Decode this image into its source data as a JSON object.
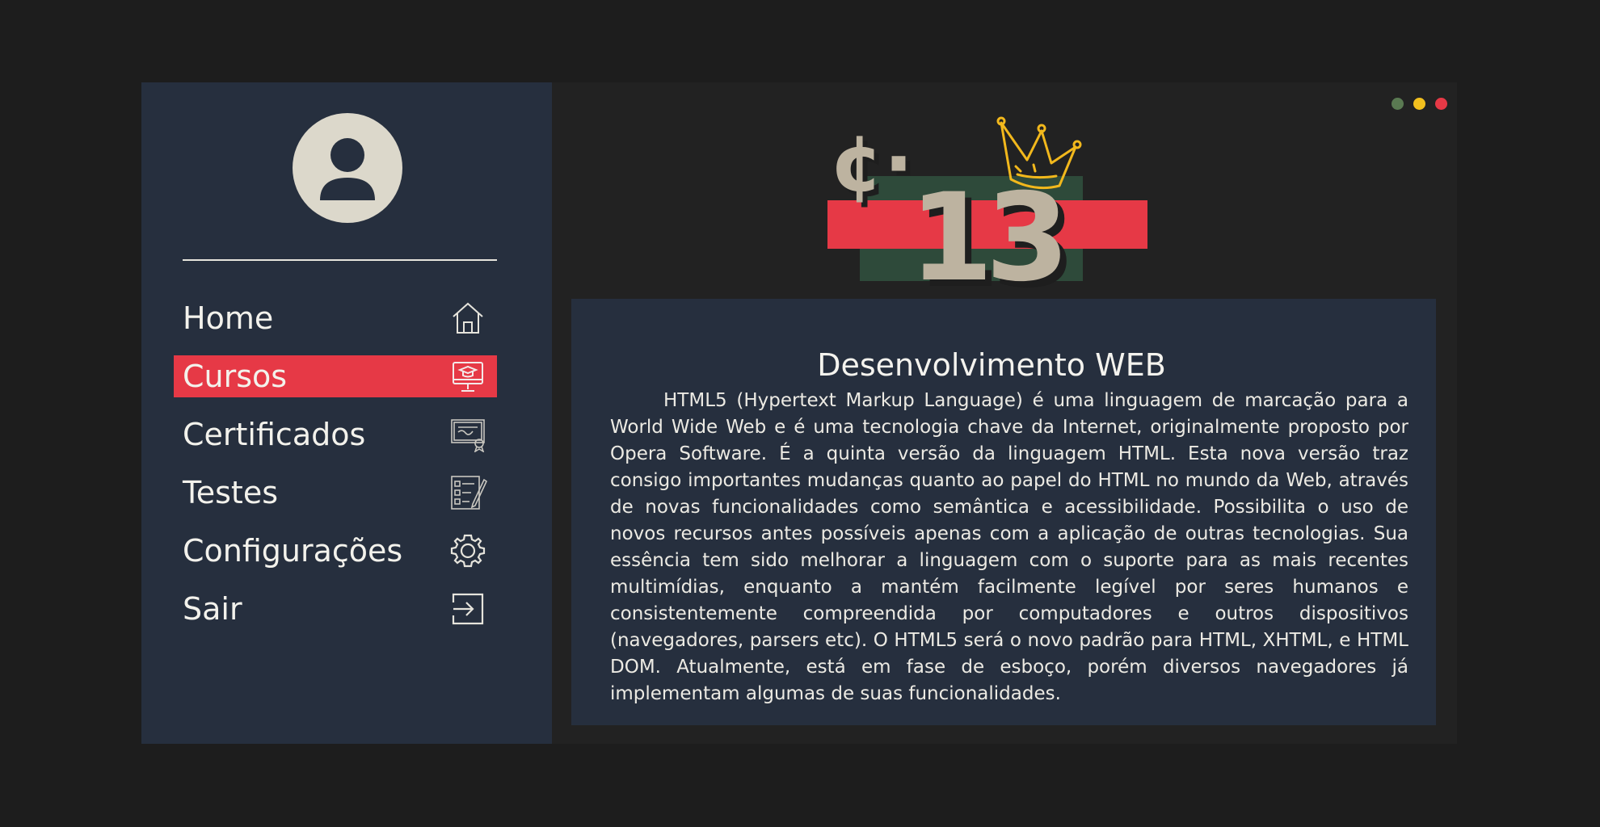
{
  "sidebar": {
    "items": [
      {
        "label": "Home",
        "icon": "home-icon",
        "active": false
      },
      {
        "label": "Cursos",
        "icon": "course-monitor-icon",
        "active": true
      },
      {
        "label": "Certificados",
        "icon": "certificate-icon",
        "active": false
      },
      {
        "label": "Testes",
        "icon": "checklist-icon",
        "active": false
      },
      {
        "label": "Configurações",
        "icon": "gear-icon",
        "active": false
      },
      {
        "label": "Sair",
        "icon": "logout-icon",
        "active": false
      }
    ]
  },
  "hero": {
    "badge_number": "13",
    "badge_symbol": "¢·"
  },
  "content": {
    "title": "Desenvolvimento WEB",
    "body": "HTML5 (Hypertext Markup Language) é uma linguagem de marcação para a World Wide Web e é uma tecnologia chave da Internet, originalmente proposto por Opera Software. É a quinta versão da linguagem HTML. Esta nova versão traz consigo importantes mudanças quanto ao papel do HTML no mundo da Web, através de novas funcionalidades como semântica e acessibilidade. Possibilita o uso de novos recursos antes possíveis apenas com a aplicação de outras tecnologias. Sua essência tem sido melhorar a linguagem com o suporte para as mais recentes multimídias, enquanto a mantém facilmente legível por seres humanos e consistentemente compreendida por computadores e outros dispositivos (navegadores, parsers etc). O HTML5 será o novo padrão para HTML, XHTML, e HTML DOM. Atualmente,  está em fase de esboço, porém diversos navegadores já implementam algumas de suas funcionalidades."
  },
  "colors": {
    "accent": "#e63946",
    "sidebar_bg": "#262f3e",
    "window_dot_green": "#5a7a52",
    "window_dot_yellow": "#f2c01e",
    "window_dot_red": "#e63946"
  }
}
